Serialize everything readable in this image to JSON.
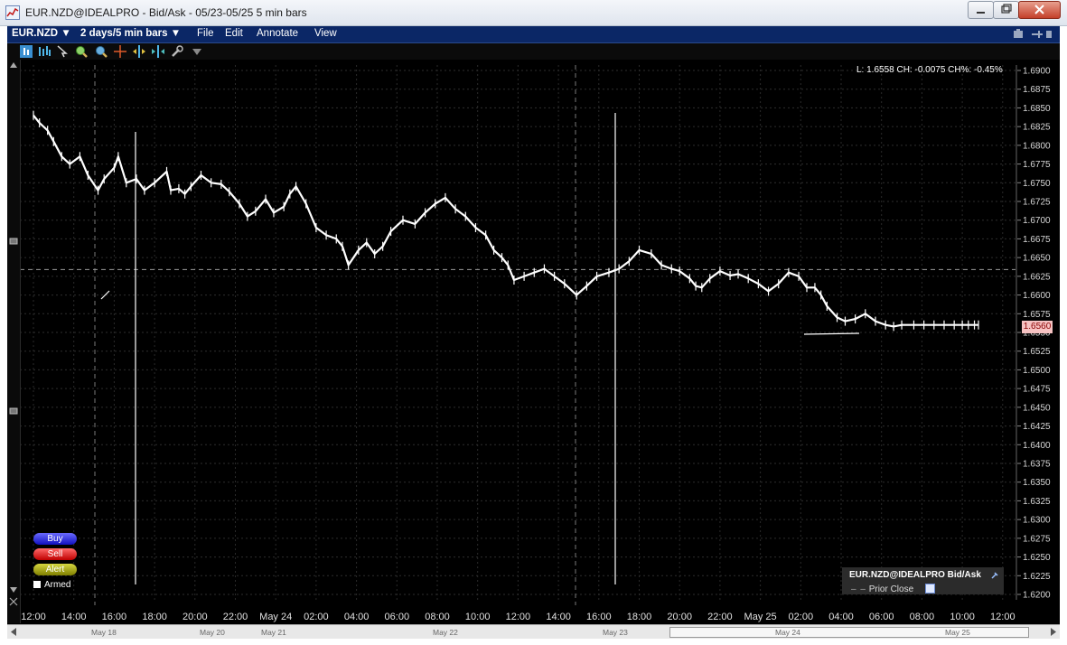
{
  "window": {
    "title": "EUR.NZD@IDEALPRO - Bid/Ask - 05/23-05/25  5 min bars"
  },
  "menubar": {
    "symbol": "EUR.NZD",
    "period": "2 days/5 min bars",
    "items": [
      {
        "label": "File"
      },
      {
        "label": "Edit"
      },
      {
        "label": "Annotate"
      },
      {
        "label": "View"
      }
    ]
  },
  "toolbar": {
    "icons": [
      "chart-type-icon",
      "bar-chart-icon",
      "cursor-icon",
      "zoom-in-icon",
      "zoom-out-icon",
      "crosshair-icon",
      "pan-icon",
      "fit-icon",
      "settings-icon",
      "dropdown-icon"
    ]
  },
  "stats": {
    "text": "L: 1.6558 CH: -0.0075 CH%: -0.45%"
  },
  "current_price": {
    "label": "1.6560",
    "value": 1.656
  },
  "order_buttons": {
    "buy": "Buy",
    "sell": "Sell",
    "alert": "Alert",
    "armed": "Armed"
  },
  "legend": {
    "title": "EUR.NZD@IDEALPRO Bid/Ask",
    "prior_close": "Prior Close"
  },
  "scrollbar": {
    "labels": [
      "May 18",
      "May 20",
      "May 21",
      "May 22",
      "May 23",
      "May 24",
      "May 25"
    ]
  },
  "colors": {
    "background": "#000000",
    "price": "#ffffff",
    "grid": "#4a4a4a",
    "menubar": "#0b2766",
    "current_price_bg": "#f6c2c2"
  },
  "chart_data": {
    "type": "line",
    "title": "",
    "xlabel": "",
    "ylabel": "",
    "ylim": [
      1.62,
      1.69
    ],
    "yticks": [
      1.62,
      1.6225,
      1.625,
      1.6275,
      1.63,
      1.6325,
      1.635,
      1.6375,
      1.64,
      1.6425,
      1.645,
      1.6475,
      1.65,
      1.6525,
      1.655,
      1.6575,
      1.66,
      1.6625,
      1.665,
      1.6675,
      1.67,
      1.6725,
      1.675,
      1.6775,
      1.68,
      1.6825,
      1.685,
      1.6875,
      1.69
    ],
    "x_labels": [
      "12:00",
      "14:00",
      "16:00",
      "18:00",
      "20:00",
      "22:00",
      "May 24",
      "02:00",
      "04:00",
      "06:00",
      "08:00",
      "10:00",
      "12:00",
      "14:00",
      "16:00",
      "18:00",
      "20:00",
      "22:00",
      "May 25",
      "02:00",
      "04:00",
      "06:00",
      "08:00",
      "10:00",
      "12:00"
    ],
    "x_range_hours": [
      0,
      48
    ],
    "x": [
      0.0,
      0.3,
      0.7,
      1.0,
      1.4,
      1.8,
      2.3,
      2.7,
      3.2,
      3.5,
      4.0,
      4.2,
      4.6,
      5.1,
      5.5,
      6.0,
      6.6,
      6.8,
      7.2,
      7.5,
      7.8,
      8.3,
      8.8,
      9.3,
      9.7,
      10.2,
      10.6,
      11.0,
      11.5,
      11.9,
      12.4,
      12.7,
      13.0,
      13.5,
      14.0,
      14.5,
      15.0,
      15.3,
      15.6,
      16.1,
      16.5,
      16.9,
      17.3,
      17.7,
      18.3,
      18.9,
      19.4,
      19.9,
      20.4,
      20.9,
      21.4,
      21.9,
      22.4,
      22.8,
      23.2,
      23.5,
      23.8,
      24.3,
      24.8,
      25.3,
      25.8,
      26.3,
      26.9,
      27.4,
      27.9,
      28.5,
      29.0,
      29.5,
      30.0,
      30.6,
      31.1,
      31.6,
      32.0,
      32.5,
      32.8,
      33.1,
      33.5,
      34.0,
      34.5,
      34.9,
      35.4,
      35.9,
      36.4,
      36.9,
      37.4,
      37.9,
      38.3,
      38.7,
      39.0,
      39.3,
      39.8,
      40.2,
      40.7,
      41.2,
      41.7,
      42.2,
      42.6,
      43.0,
      43.6,
      44.1,
      44.6,
      45.1,
      45.6,
      46.0,
      46.3,
      46.6,
      46.8
    ],
    "series": [
      {
        "values": [
          1.684,
          1.683,
          1.682,
          1.6805,
          1.6785,
          1.6775,
          1.6785,
          1.676,
          1.674,
          1.6755,
          1.677,
          1.6785,
          1.675,
          1.6755,
          1.674,
          1.675,
          1.6765,
          1.674,
          1.6742,
          1.6735,
          1.6745,
          1.676,
          1.675,
          1.6748,
          1.6738,
          1.6722,
          1.6705,
          1.6712,
          1.6728,
          1.671,
          1.6718,
          1.6735,
          1.6745,
          1.6722,
          1.669,
          1.668,
          1.6675,
          1.6665,
          1.664,
          1.666,
          1.667,
          1.6655,
          1.6665,
          1.6685,
          1.67,
          1.6695,
          1.671,
          1.6722,
          1.673,
          1.6715,
          1.6705,
          1.669,
          1.668,
          1.666,
          1.665,
          1.664,
          1.662,
          1.6625,
          1.663,
          1.6635,
          1.6625,
          1.6615,
          1.66,
          1.6612,
          1.6625,
          1.663,
          1.6635,
          1.6645,
          1.666,
          1.6655,
          1.664,
          1.6635,
          1.6632,
          1.6622,
          1.6612,
          1.661,
          1.6622,
          1.6632,
          1.6626,
          1.6628,
          1.6622,
          1.6615,
          1.6605,
          1.6615,
          1.663,
          1.6625,
          1.661,
          1.661,
          1.66,
          1.6585,
          1.657,
          1.6565,
          1.6568,
          1.6575,
          1.6565,
          1.656,
          1.6558,
          1.656,
          1.656,
          1.656,
          1.656,
          1.656,
          1.656,
          1.656,
          1.656,
          1.656,
          1.656
        ]
      }
    ],
    "grid": true,
    "prior_close": 1.6634
  }
}
